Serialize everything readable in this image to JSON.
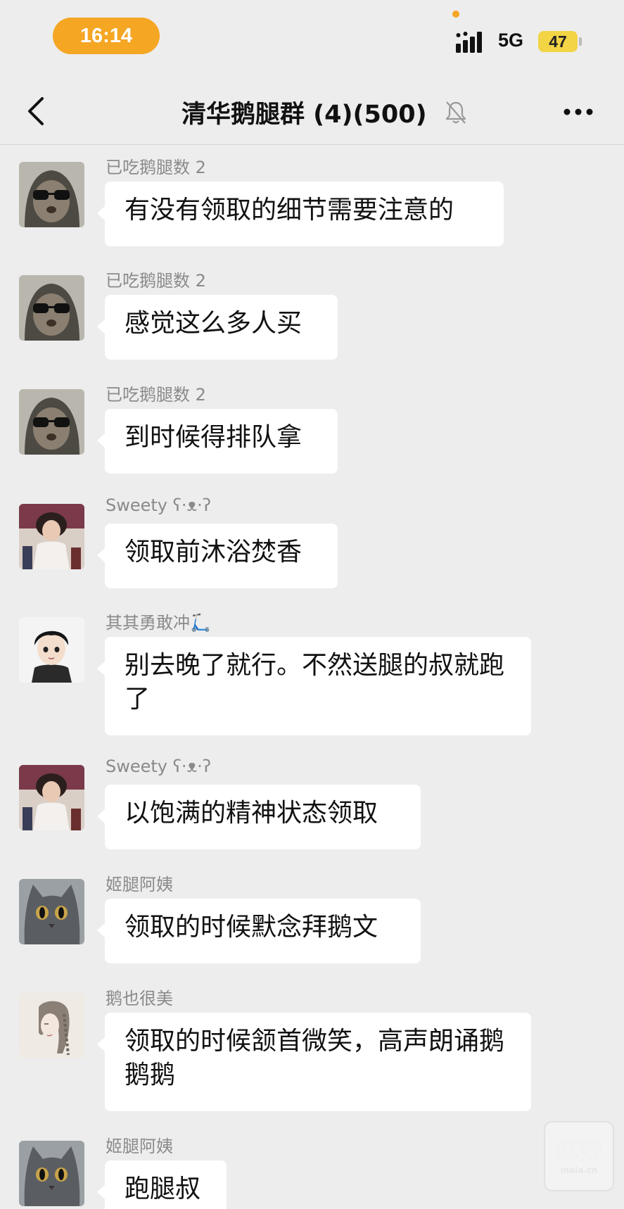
{
  "status_bar": {
    "time": "16:14",
    "network": "5G",
    "battery": "47"
  },
  "header": {
    "title": "清华鹅腿群 (4)(500)"
  },
  "messages": [
    {
      "sender": "已吃鹅腿数 2",
      "text": "有没有领取的细节需要注意的",
      "avatar": "sunglasses-bear-avatar"
    },
    {
      "sender": "已吃鹅腿数 2",
      "text": "感觉这么多人买",
      "avatar": "sunglasses-bear-avatar"
    },
    {
      "sender": "已吃鹅腿数 2",
      "text": "到时候得排队拿",
      "avatar": "sunglasses-bear-avatar"
    },
    {
      "sender": "Sweety ʕ·ᴥ·ʔ",
      "text": "领取前沐浴焚香",
      "avatar": "girl-photo-avatar"
    },
    {
      "sender": "其其勇敢冲🛴",
      "text": "别去晚了就行。不然送腿的叔就跑了",
      "avatar": "cartoon-boy-avatar"
    },
    {
      "sender": "Sweety ʕ·ᴥ·ʔ",
      "text": "以饱满的精神状态领取",
      "avatar": "girl-photo-avatar"
    },
    {
      "sender": "姬腿阿姨",
      "text": "领取的时候默念拜鹅文",
      "avatar": "grey-cat-avatar"
    },
    {
      "sender": "鹅也很美",
      "text": "领取的时候颔首微笑，高声朗诵鹅鹅鹅",
      "avatar": "sketch-girl-avatar"
    },
    {
      "sender": "姬腿阿姨",
      "text": "跑腿叔",
      "avatar": "grey-cat-avatar"
    }
  ],
  "watermark": {
    "text": "麻辣",
    "sub": "mala.cn"
  },
  "colors": {
    "background": "#ededed",
    "bubble": "#ffffff",
    "time_pill": "#f5a623",
    "battery": "#f2d445"
  }
}
